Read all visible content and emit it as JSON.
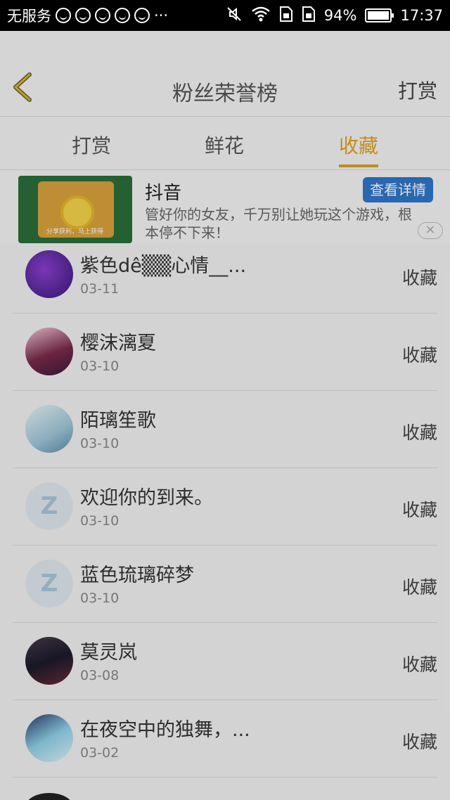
{
  "status_bar": {
    "carrier": "无服务",
    "more": "···",
    "battery": "94%",
    "time": "17:37"
  },
  "header": {
    "title": "粉丝荣誉榜",
    "action": "打赏"
  },
  "tabs": [
    {
      "label": "打赏"
    },
    {
      "label": "鲜花"
    },
    {
      "label": "收藏",
      "active": true
    }
  ],
  "ad": {
    "title": "抖音",
    "description": "管好你的女友，千万别让她玩这个游戏，根本停不下来！",
    "detail_button": "查看详情",
    "thumb_caption": "分享获利，马上获得"
  },
  "list": [
    {
      "name": "紫色dê▒▒心情__...",
      "date": "03-11",
      "action": "收藏",
      "avatar": "purple"
    },
    {
      "name": "樱沫漓夏",
      "date": "03-10",
      "action": "收藏",
      "avatar": "anime-pink"
    },
    {
      "name": "陌璃笙歌",
      "date": "03-10",
      "action": "收藏",
      "avatar": "anime-blue"
    },
    {
      "name": "欢迎你的到来。",
      "date": "03-10",
      "action": "收藏",
      "avatar": "default-z"
    },
    {
      "name": "蓝色琉璃碎梦",
      "date": "03-10",
      "action": "收藏",
      "avatar": "default-z"
    },
    {
      "name": "莫灵岚",
      "date": "03-08",
      "action": "收藏",
      "avatar": "anime-dark"
    },
    {
      "name": "在夜空中的独舞，...",
      "date": "03-02",
      "action": "收藏",
      "avatar": "anime-blue"
    }
  ],
  "colors": {
    "accent": "#d6a127",
    "ad_button": "#2f76c9"
  }
}
